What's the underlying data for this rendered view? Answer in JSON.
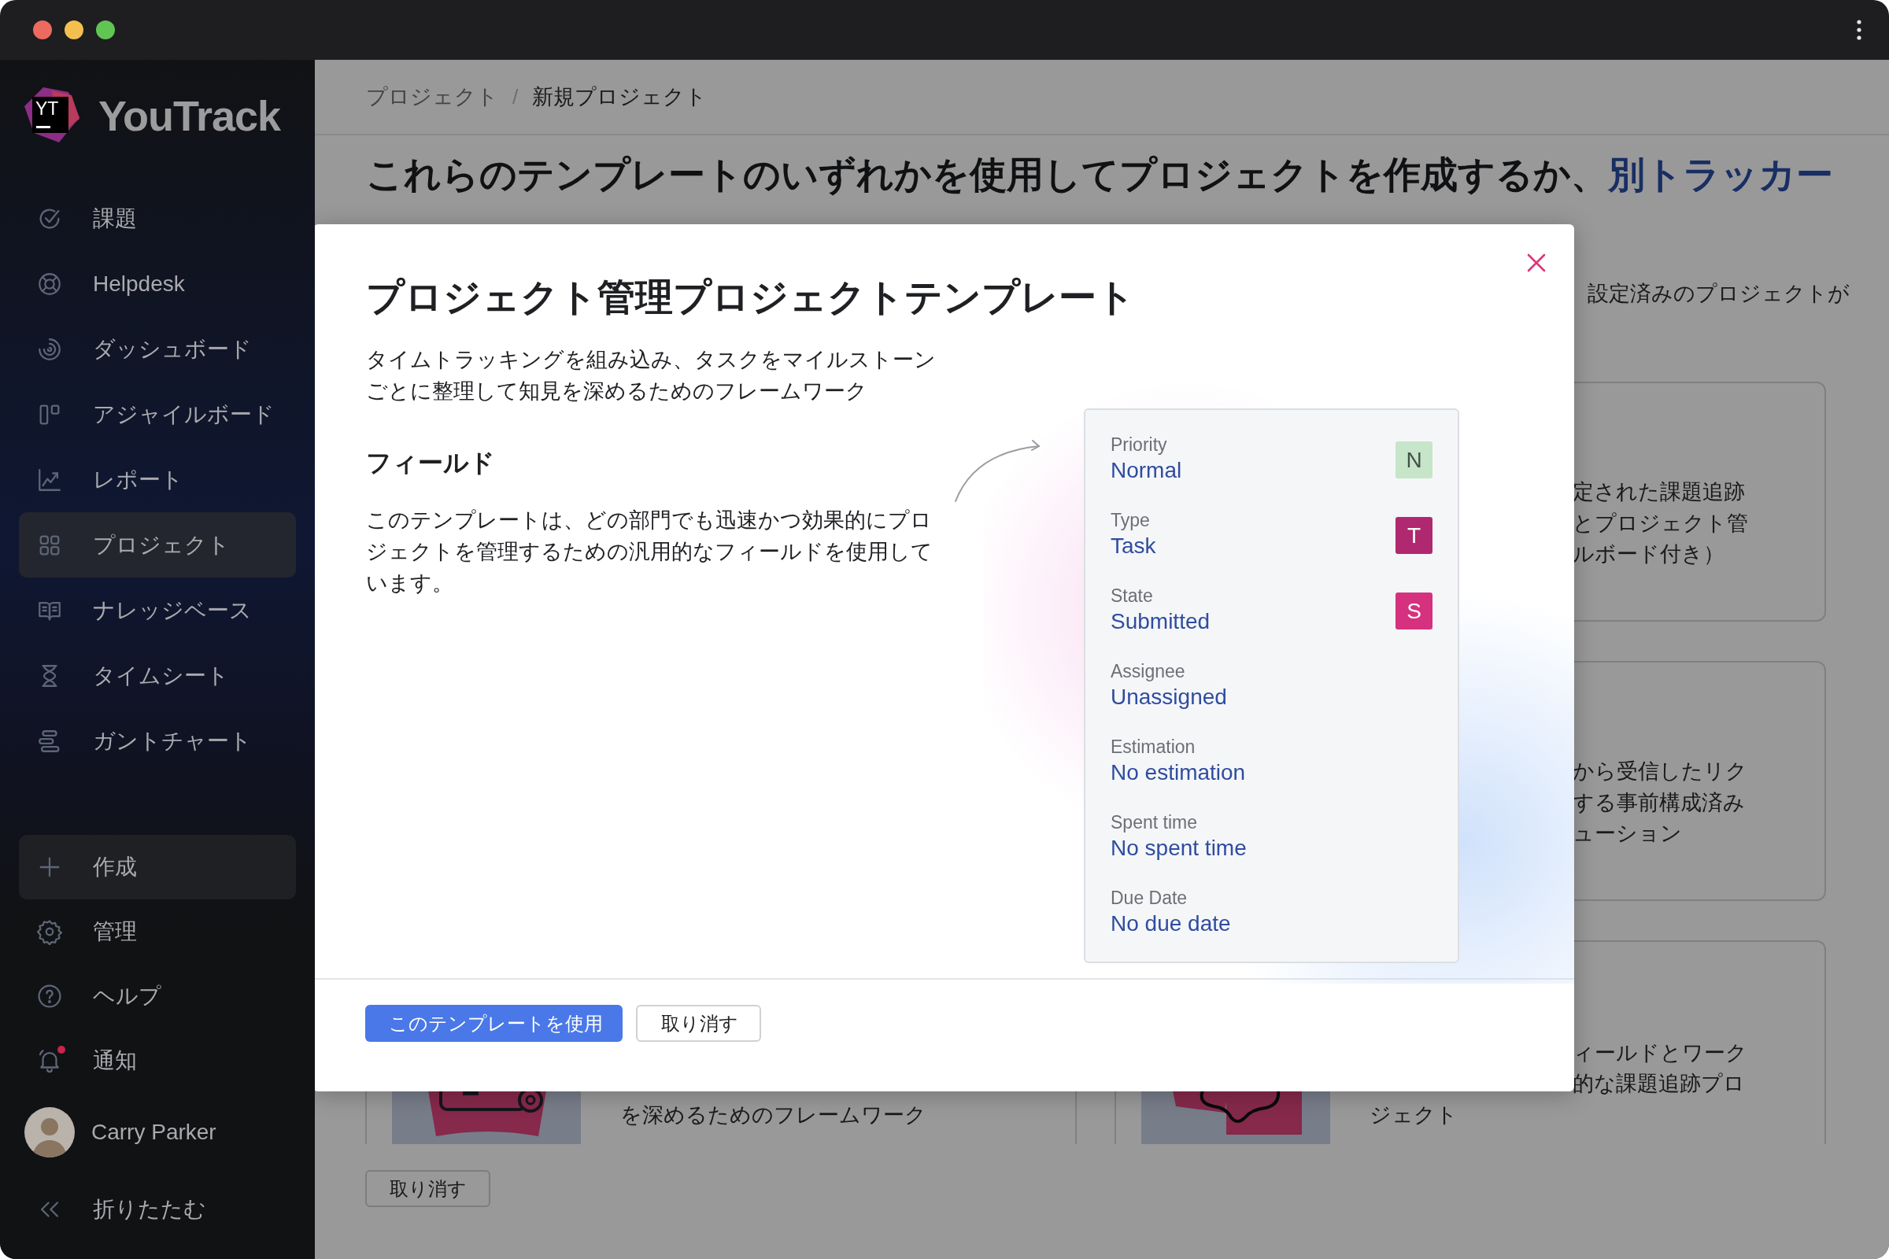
{
  "sidebar": {
    "logo": {
      "mark": "YT",
      "name": "YouTrack"
    },
    "items": [
      {
        "label": "課題",
        "selected": false
      },
      {
        "label": "Helpdesk",
        "selected": false
      },
      {
        "label": "ダッシュボード",
        "selected": false
      },
      {
        "label": "アジャイルボード",
        "selected": false
      },
      {
        "label": "レポート",
        "selected": false
      },
      {
        "label": "プロジェクト",
        "selected": true
      },
      {
        "label": "ナレッジベース",
        "selected": false
      },
      {
        "label": "タイムシート",
        "selected": false
      },
      {
        "label": "ガントチャート",
        "selected": false
      }
    ],
    "actions": [
      {
        "label": "作成",
        "kind": "button",
        "unread": false
      },
      {
        "label": "管理",
        "kind": "link",
        "unread": false
      },
      {
        "label": "ヘルプ",
        "kind": "link",
        "unread": false
      },
      {
        "label": "通知",
        "kind": "link",
        "unread": true
      }
    ],
    "user": {
      "name": "Carry Parker"
    },
    "collapse": {
      "label": "折りたたむ"
    }
  },
  "breadcrumb": {
    "separator": "/",
    "items": [
      {
        "label": "プロジェクト",
        "current": false
      },
      {
        "label": "新規プロジェクト",
        "current": true
      }
    ]
  },
  "heading": {
    "text": "これらのテンプレートのいずれかを使用してプロジェクトを作成するか、",
    "link": "別トラッカー"
  },
  "subtitle": "設定済みのプロジェクトが",
  "template_cards": [
    {
      "kind": "text",
      "lines": [
        "定された課題追跡",
        "とプロジェクト管",
        "ルボード付き）"
      ]
    },
    {
      "kind": "text",
      "lines": [
        "から受信したリク",
        "する事前構成済み",
        "ューション"
      ]
    },
    {
      "kind": "picture",
      "lines": [
        "を深めるためのフレームワーク"
      ]
    },
    {
      "kind": "picture",
      "lines": [
        "ィールドとワーク",
        "的な課題追跡プロ",
        "ジェクト"
      ]
    }
  ],
  "cancel_button": "取り消す",
  "dialog": {
    "title": "プロジェクト管理プロジェクトテンプレート",
    "description": "タイムトラッキングを組み込み、タスクをマイルストーンごとに整理して知見を深めるためのフレームワーク",
    "fields_heading": "フィールド",
    "fields_text": "このテンプレートは、どの部門でも迅速かつ効果的にプロジェクトを管理するための汎用的なフィールドを使用しています。",
    "fields": [
      {
        "label": "Priority",
        "value": "Normal",
        "badge": "N",
        "color": "#c6e5c9"
      },
      {
        "label": "Type",
        "value": "Task",
        "badge": "T",
        "color": "#b0286f"
      },
      {
        "label": "State",
        "value": "Submitted",
        "badge": "S",
        "color": "#d6317e"
      },
      {
        "label": "Assignee",
        "value": "Unassigned"
      },
      {
        "label": "Estimation",
        "value": "No estimation"
      },
      {
        "label": "Spent time",
        "value": "No spent time"
      },
      {
        "label": "Due Date",
        "value": "No due date"
      }
    ],
    "primary_button": "このテンプレートを使用",
    "cancel_button": "取り消す"
  }
}
